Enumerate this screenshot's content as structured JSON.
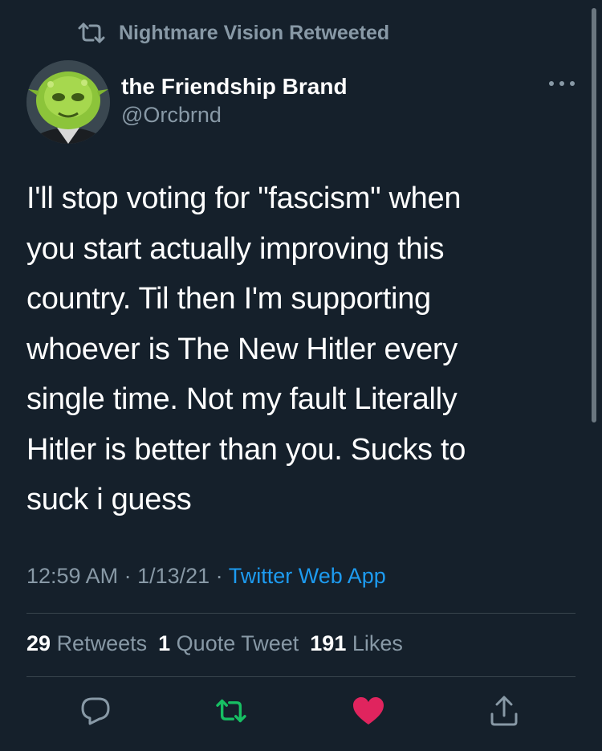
{
  "retweet": {
    "label": "Nightmare Vision Retweeted",
    "icon": "retweet-icon"
  },
  "author": {
    "name": "the Friendship Brand",
    "handle": "@Orcbrnd"
  },
  "tweet": {
    "lines": [
      "I'll stop voting for \"fascism\" when",
      "you start actually improving this",
      "country. Til then I'm supporting",
      "whoever is The New Hitler every",
      "single time. Not my fault Literally",
      "Hitler is better than you. Sucks to",
      "suck i guess"
    ]
  },
  "meta": {
    "time": "12:59 AM",
    "separator1": " · ",
    "date": "1/13/21",
    "separator2": " · ",
    "source": "Twitter Web App"
  },
  "stats": {
    "retweets_count": "29",
    "retweets_label": "Retweets",
    "quotes_count": "1",
    "quotes_label": "Quote Tweet",
    "likes_count": "191",
    "likes_label": "Likes"
  },
  "actions": {
    "reply": "reply-icon",
    "retweet": "retweet-icon",
    "like": "heart-icon",
    "share": "share-icon"
  },
  "colors": {
    "background": "#15202b",
    "secondary_text": "#8899a6",
    "link": "#1d9bf0",
    "retweet_active": "#17bf63",
    "like_active": "#e0245e",
    "divider": "#38444d"
  }
}
